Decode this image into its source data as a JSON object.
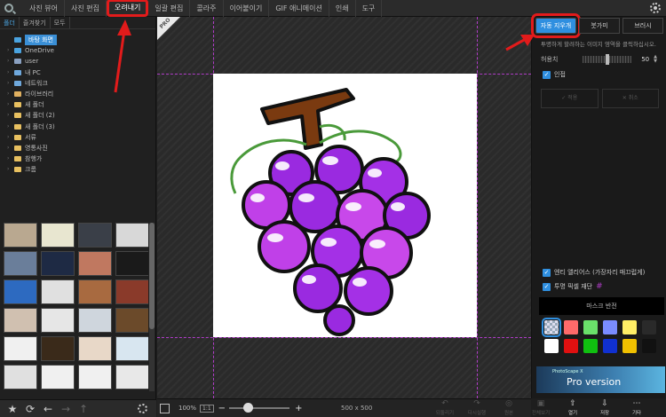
{
  "menu": {
    "items": [
      "사진 뷰어",
      "사진 편집",
      "오려내기",
      "일괄 편집",
      "콜라주",
      "이어붙이기",
      "GIF 애니메이션",
      "인쇄",
      "도구"
    ],
    "active_index": 2
  },
  "left_tabs": [
    "폴더",
    "즐겨찾기",
    "모두"
  ],
  "tree": [
    {
      "label": "바탕 화면",
      "selected": true,
      "color": "#4aa3e0"
    },
    {
      "label": "OneDrive",
      "color": "#4aa3e0"
    },
    {
      "label": "user",
      "color": "#8aa0c0"
    },
    {
      "label": "내 PC",
      "color": "#6fa8dc"
    },
    {
      "label": "네트워크",
      "color": "#6fa8dc"
    },
    {
      "label": "라이브러리",
      "color": "#e0b060"
    },
    {
      "label": "새 폴더",
      "color": "#e8c060"
    },
    {
      "label": "새 폴더 (2)",
      "color": "#e8c060"
    },
    {
      "label": "새 폴더 (3)",
      "color": "#e8c060"
    },
    {
      "label": "서류",
      "color": "#e8c060"
    },
    {
      "label": "영통사진",
      "color": "#e8c060"
    },
    {
      "label": "참행가",
      "color": "#e8c060"
    },
    {
      "label": "크롬",
      "color": "#e8c060"
    }
  ],
  "canvas": {
    "zoom": "100%",
    "one_to_one": "1:1",
    "image_size": "500 x 500"
  },
  "actions": [
    {
      "label": "되돌리기",
      "on": false
    },
    {
      "label": "다시실행",
      "on": false
    },
    {
      "label": "원본",
      "on": false
    },
    {
      "label": "전체보기",
      "on": false
    },
    {
      "label": "열기",
      "on": true
    },
    {
      "label": "저장",
      "on": true
    },
    {
      "label": "기타",
      "on": true
    }
  ],
  "right": {
    "tabs": [
      "자동 지우개",
      "붓가미",
      "브러시"
    ],
    "active_tab": 0,
    "description": "투명하게 할려하는 이미지 영역을 클릭하십시오.",
    "tolerance_label": "허용치",
    "tolerance_value": "50",
    "tolerance_fraction": 0.5,
    "adjacent_label": "인접",
    "btn_apply": "적용",
    "btn_cancel": "취소",
    "edge_label": "엔티 앨리어스 (가장자리 매끄럽게)",
    "transparent_label": "투명 픽셀 재단",
    "mask_label": "마스크 반전",
    "swatch_colors": [
      "checker",
      "#ff6a6a",
      "#6ae06a",
      "#7a8cff",
      "#ffee66",
      "#2a2a2a",
      "#ffffff",
      "#e01010",
      "#10c010",
      "#1030d0",
      "#f0c000",
      "#111111"
    ],
    "pro_small": "PhotoScape X",
    "pro_text": "Pro version"
  }
}
